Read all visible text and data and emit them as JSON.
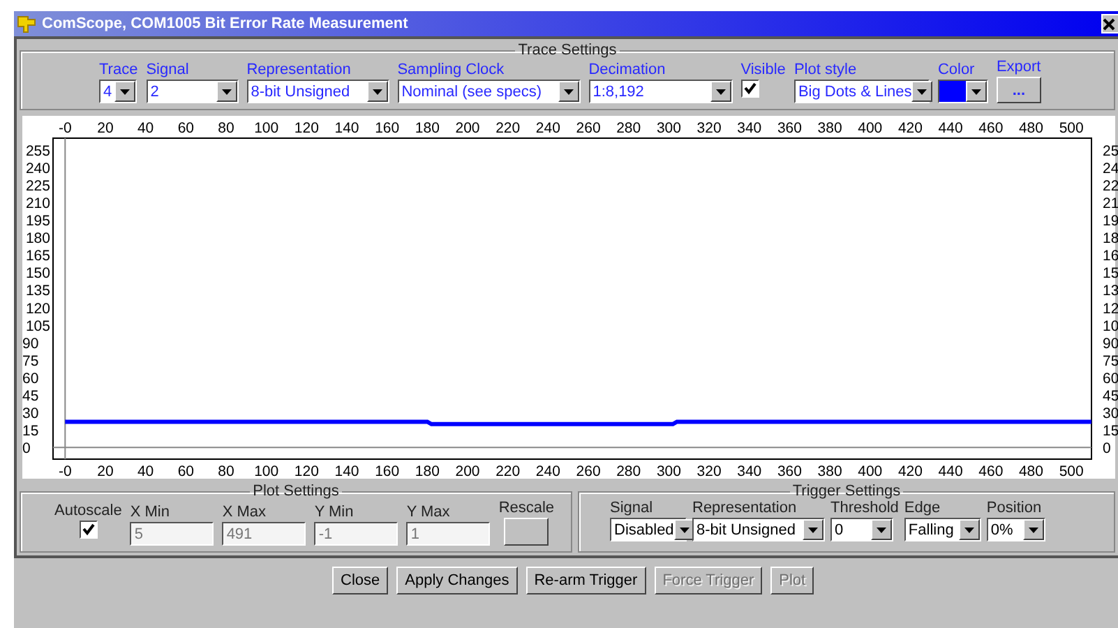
{
  "window": {
    "title": "ComScope, COM1005 Bit Error Rate Measurement"
  },
  "trace_settings": {
    "title": "Trace Settings",
    "controls": [
      {
        "kind": "dropdown",
        "label": "Trace",
        "value": "4"
      },
      {
        "kind": "dropdown",
        "label": "Signal",
        "value": "2"
      },
      {
        "kind": "dropdown",
        "label": "Representation",
        "value": "8-bit Unsigned"
      },
      {
        "kind": "dropdown",
        "label": "Sampling Clock",
        "value": "Nominal (see specs)"
      },
      {
        "kind": "dropdown",
        "label": "Decimation",
        "value": "1:8,192"
      },
      {
        "kind": "checkbox",
        "label": "Visible",
        "checked": true
      },
      {
        "kind": "dropdown",
        "label": "Plot style",
        "value": "Big Dots & Lines"
      },
      {
        "kind": "color",
        "label": "Color",
        "color": "#0000ff"
      },
      {
        "kind": "button",
        "label": "Export",
        "value": "..."
      }
    ]
  },
  "plot": {
    "chart_data": {
      "type": "line",
      "x": [
        0,
        180,
        182,
        302,
        304,
        510
      ],
      "series": [
        {
          "color": "#0000ff",
          "values": [
            22,
            22,
            20,
            20,
            22,
            22
          ]
        }
      ],
      "xlim": [
        -6,
        510
      ],
      "ylim": [
        -10,
        265
      ],
      "xticks": [
        {
          "value": 0,
          "label": "-0"
        },
        20,
        40,
        60,
        80,
        100,
        120,
        140,
        160,
        180,
        200,
        220,
        240,
        260,
        280,
        300,
        320,
        340,
        360,
        380,
        400,
        420,
        440,
        460,
        480,
        500
      ],
      "yticks": [
        0,
        15,
        30,
        45,
        60,
        75,
        90,
        105,
        120,
        135,
        150,
        165,
        180,
        195,
        210,
        225,
        240,
        255
      ]
    },
    "top_axis_labels": [
      "-0",
      "20",
      "40",
      "60",
      "80",
      "100",
      "120",
      "140",
      "160",
      "180",
      "200",
      "220",
      "240",
      "260",
      "280",
      "300",
      "320",
      "340",
      "360",
      "380",
      "400",
      "420",
      "440",
      "460",
      "480",
      "500"
    ],
    "right_axis_labels": [
      "25",
      "24",
      "22",
      "21",
      "19",
      "18",
      "16",
      "15",
      "13",
      "12",
      "10",
      "90",
      "75",
      "60",
      "45",
      "30",
      "15",
      "0"
    ]
  },
  "plot_settings": {
    "title": "Plot Settings",
    "autoscale": {
      "label": "Autoscale",
      "checked": true
    },
    "fields": [
      {
        "label": "X Min",
        "value": "5",
        "disabled": true
      },
      {
        "label": "X Max",
        "value": "491",
        "disabled": true
      },
      {
        "label": "Y Min",
        "value": "-1",
        "disabled": true
      },
      {
        "label": "Y Max",
        "value": "1",
        "disabled": true
      }
    ],
    "rescale_label": "Rescale"
  },
  "trigger_settings": {
    "title": "Trigger Settings",
    "controls": [
      {
        "label": "Signal",
        "value": "Disabled"
      },
      {
        "label": "Representation",
        "value": "8-bit Unsigned"
      },
      {
        "label": "Threshold",
        "value": "0"
      },
      {
        "label": "Edge",
        "value": "Falling"
      },
      {
        "label": "Position",
        "value": "0%"
      }
    ]
  },
  "buttons": [
    {
      "label": "Close",
      "disabled": false
    },
    {
      "label": "Apply Changes",
      "disabled": false
    },
    {
      "label": "Re-arm Trigger",
      "disabled": false
    },
    {
      "label": "Force Trigger",
      "disabled": true
    },
    {
      "label": "Plot",
      "disabled": true
    }
  ]
}
